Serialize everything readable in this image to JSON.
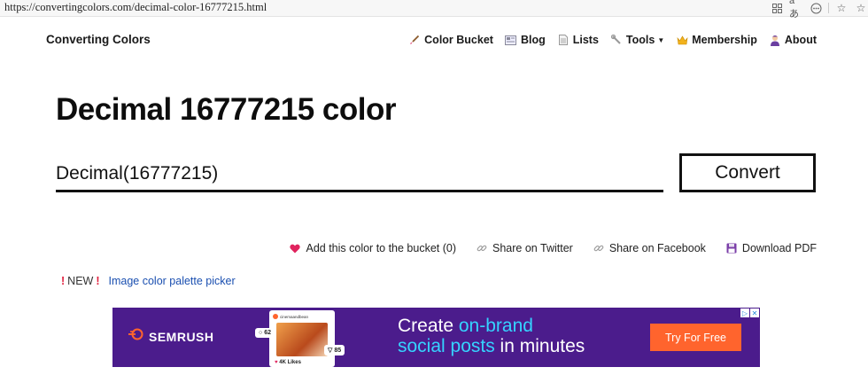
{
  "browser": {
    "url": "https://convertingcolors.com/decimal-color-16777215.html",
    "icons": [
      "grid-icon",
      "translate-icon",
      "more-icon",
      "favorite-icon",
      "collections-icon"
    ]
  },
  "header": {
    "brand": "Converting Colors",
    "nav": [
      {
        "label": "Color Bucket",
        "icon": "brush-icon"
      },
      {
        "label": "Blog",
        "icon": "newspaper-icon"
      },
      {
        "label": "Lists",
        "icon": "document-icon"
      },
      {
        "label": "Tools",
        "icon": "wrench-icon",
        "dropdown": true
      },
      {
        "label": "Membership",
        "icon": "crown-icon"
      },
      {
        "label": "About",
        "icon": "person-icon"
      }
    ]
  },
  "page": {
    "title": "Decimal 16777215 color"
  },
  "converter": {
    "input_value": "Decimal(16777215)",
    "button_label": "Convert"
  },
  "actions": [
    {
      "label": "Add this color to the bucket (0)",
      "icon": "heart-icon"
    },
    {
      "label": "Share on Twitter",
      "icon": "link-icon"
    },
    {
      "label": "Share on Facebook",
      "icon": "link-icon"
    },
    {
      "label": "Download PDF",
      "icon": "floppy-icon"
    }
  ],
  "new_banner": {
    "new_label": "NEW",
    "link_label": "Image color palette picker"
  },
  "ad": {
    "brand": "SEMRUSH",
    "card_user": "cinemaandbean",
    "comments": "62",
    "shares": "85",
    "likes": "4K Likes",
    "headline_line1_plain": "Create ",
    "headline_line1_highlight": "on-brand",
    "headline_line2_highlight": "social posts",
    "headline_line2_plain": " in minutes",
    "cta": "Try For Free",
    "colors": {
      "background": "#4b1c8c",
      "highlight": "#35d3ff",
      "cta": "#ff642d"
    }
  }
}
